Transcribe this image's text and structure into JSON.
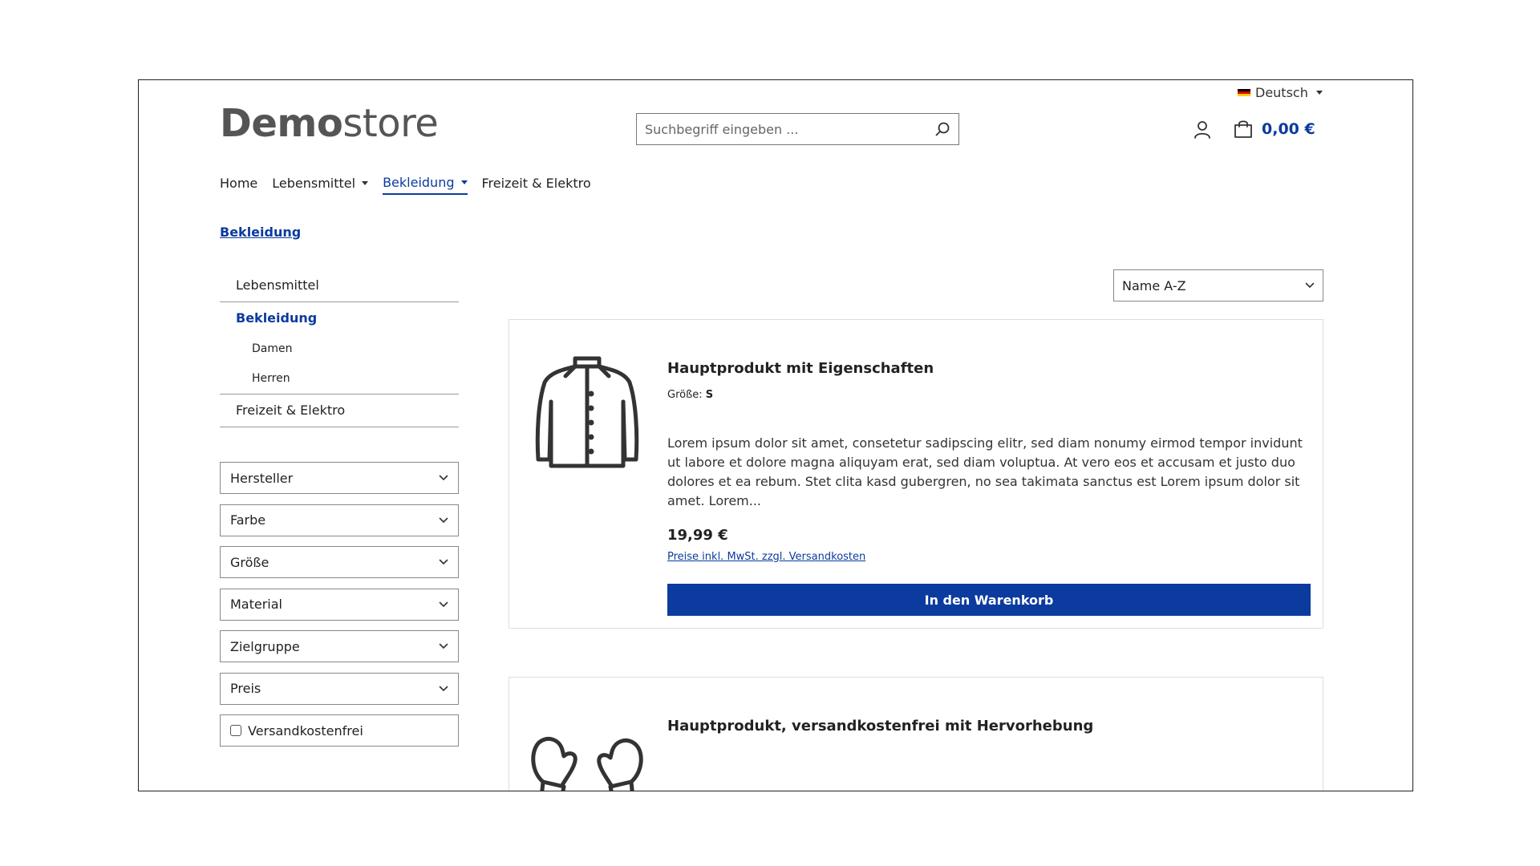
{
  "language": {
    "label": "Deutsch",
    "flag_colors": [
      "#000000",
      "#dd0000",
      "#ffce00"
    ]
  },
  "logo": {
    "bold": "Demo",
    "light": "store"
  },
  "search": {
    "placeholder": "Suchbegriff eingeben ..."
  },
  "cart": {
    "total": "0,00 €"
  },
  "nav": {
    "items": [
      {
        "label": "Home"
      },
      {
        "label": "Lebensmittel"
      },
      {
        "label": "Bekleidung"
      },
      {
        "label": "Freizeit & Elektro"
      }
    ]
  },
  "breadcrumb": "Bekleidung",
  "sidebar": {
    "categories": {
      "lebensmittel": "Lebensmittel",
      "bekleidung": "Bekleidung",
      "damen": "Damen",
      "herren": "Herren",
      "freizeit": "Freizeit & Elektro"
    },
    "filters": [
      "Hersteller",
      "Farbe",
      "Größe",
      "Material",
      "Zielgruppe",
      "Preis"
    ],
    "shipping_free": "Versandkostenfrei"
  },
  "sort": {
    "selected": "Name A-Z"
  },
  "products": [
    {
      "title": "Hauptprodukt mit Eigenschaften",
      "property_label": "Größe:",
      "property_value": "S",
      "description": "Lorem ipsum dolor sit amet, consetetur sadipscing elitr, sed diam nonumy eirmod tempor invidunt ut labore et dolore magna aliquyam erat, sed diam voluptua. At vero eos et accusam et justo duo dolores et ea rebum. Stet clita kasd gubergren, no sea takimata sanctus est Lorem ipsum dolor sit amet. Lorem...",
      "price": "19,99 €",
      "vat_note": "Preise inkl. MwSt. zzgl. Versandkosten",
      "button": "In den Warenkorb",
      "icon": "jacket-icon"
    },
    {
      "title": "Hauptprodukt, versandkostenfrei mit Hervorhebung",
      "icon": "mittens-icon"
    }
  ],
  "colors": {
    "accent": "#0b3b9e"
  }
}
